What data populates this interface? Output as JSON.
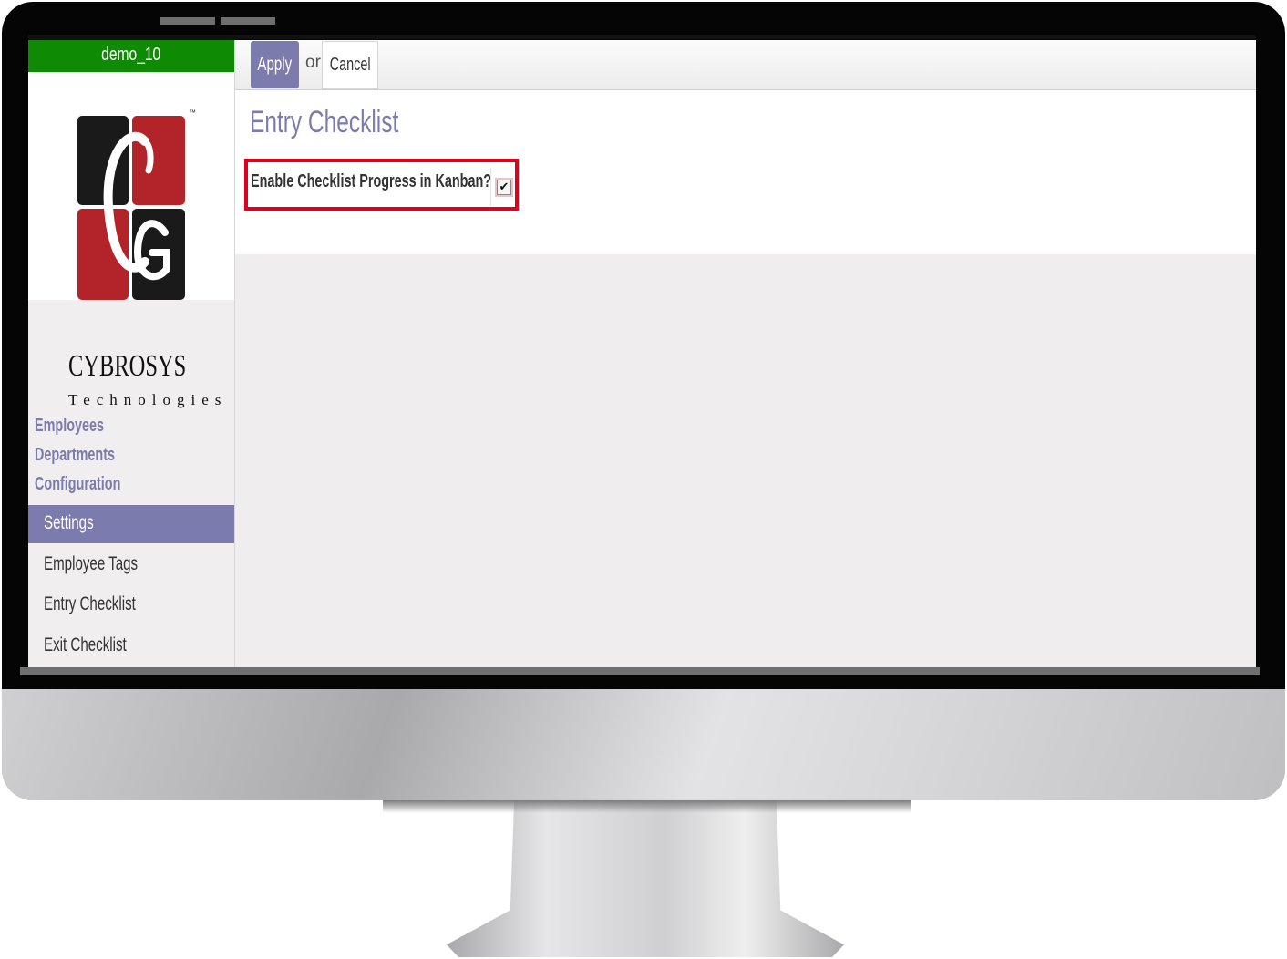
{
  "database": "demo_10",
  "brand": {
    "name": "CYBROSYS",
    "subtitle": "Technologies",
    "tm": "™"
  },
  "sidebar": {
    "menu": [
      {
        "label": "Employees"
      },
      {
        "label": "Departments"
      },
      {
        "label": "Configuration"
      }
    ],
    "active_item": "Settings",
    "submenu": [
      {
        "label": "Employee Tags"
      },
      {
        "label": "Entry Checklist"
      },
      {
        "label": "Exit Checklist"
      }
    ]
  },
  "control_bar": {
    "apply_label": "Apply",
    "or_label": "or",
    "cancel_label": "Cancel"
  },
  "form": {
    "title": "Entry Checklist",
    "field_label": "Enable Checklist Progress in Kanban?",
    "field_checked": true,
    "checkbox_glyph": "✔"
  },
  "colors": {
    "accent": "#7c7bad",
    "db_badge": "#0f8a04",
    "highlight": "#e0001b",
    "logo_red": "#b3232a",
    "logo_black": "#1a1a1a"
  }
}
